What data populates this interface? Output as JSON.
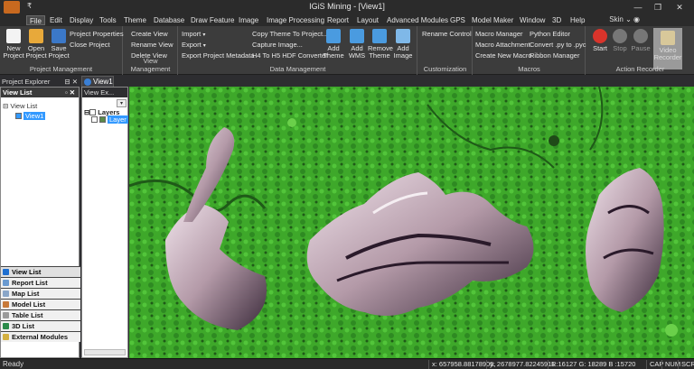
{
  "title": "IGiS Mining - [View1]",
  "qat": "₹",
  "window_buttons": [
    "—",
    "❐",
    "✕"
  ],
  "menu": [
    "File",
    "Edit",
    "Display",
    "Tools",
    "Theme",
    "Database",
    "Draw Feature",
    "Image",
    "Image Processing",
    "Report",
    "Layout",
    "Advanced Modules",
    "GPS",
    "Model Maker",
    "Window",
    "3D",
    "Help"
  ],
  "skin": {
    "label": "Skin",
    "arrows": "⌄ ◉"
  },
  "ribbon": {
    "project_mgmt": {
      "label": "Project Management",
      "new": "New Project",
      "open": "Open Project",
      "save": "Save Project",
      "props": "Project Properties",
      "close": "Close Project"
    },
    "view_mgmt": {
      "label": "View Management",
      "create": "Create View",
      "rename": "Rename View",
      "delete": "Delete View"
    },
    "data_mgmt": {
      "label": "Data Management",
      "import": "Import",
      "export": "Export",
      "export_meta": "Export Project Metadata",
      "copy_theme": "Copy Theme To Project...",
      "capture": "Capture Image...",
      "h4h5": "H4 To H5 HDF Converter",
      "add_theme": "Add Theme",
      "add_wms": "Add WMS",
      "remove_theme": "Remove Theme",
      "add_image": "Add Image"
    },
    "customization": {
      "label": "Customization",
      "rename_control": "Rename Control"
    },
    "macros": {
      "label": "Macros",
      "manager": "Macro Manager",
      "attach": "Macro Attachment",
      "create": "Create New Macro",
      "python": "Python Editor",
      "convert": "Convert .py to .pyc",
      "ribbon": "Ribbon Manager"
    },
    "action_recorder": {
      "label": "Action Recorder",
      "start": "Start",
      "stop": "Stop",
      "pause": "Pause",
      "video": "Video Recorder"
    }
  },
  "tabs": {
    "project_explorer": "Project Explorer",
    "view_explorer": "View Ex...",
    "view1": "View1"
  },
  "project_panel": {
    "header": "View List",
    "tree_root": "View List",
    "tree_child": "View1"
  },
  "view_explorer": {
    "layers": "Layers",
    "layer_sel": "Layer"
  },
  "bottom_list": [
    "View List",
    "Report List",
    "Map List",
    "Model List",
    "Table List",
    "3D List",
    "External Modules"
  ],
  "status": {
    "left": "Ready",
    "x": "x: 657958.88178905,",
    "y": "y: 2678977.82245911",
    "rgb": "R:16127  G: 18289  B :15720",
    "cap": "CAP",
    "num": "NUM",
    "scrl": "SCRL"
  },
  "colors": {
    "accent": "#3399ff",
    "vegetation": "#3fb52c",
    "pit": "#d9c7d6"
  }
}
